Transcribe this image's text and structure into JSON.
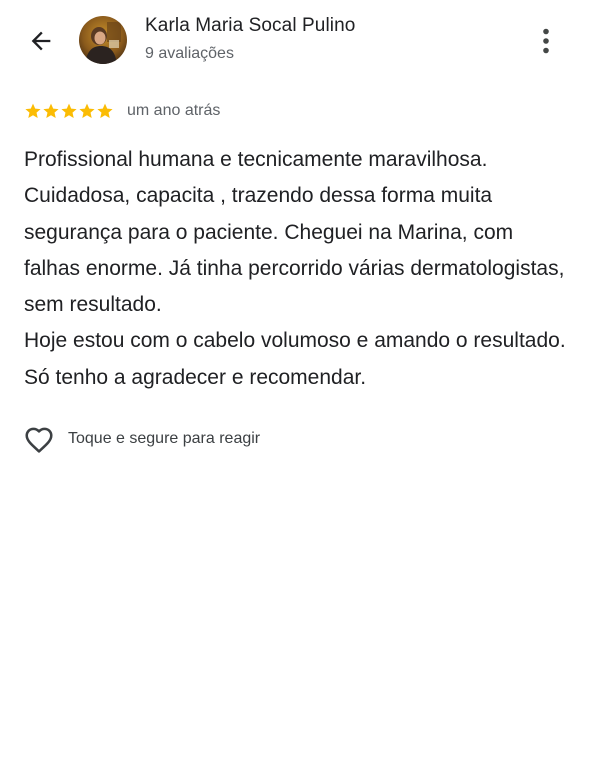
{
  "header": {
    "back_icon": "arrow-back-icon",
    "reviewer_name": "Karla Maria Socal Pulino",
    "reviews_count": "9 avaliações",
    "more_icon": "more-vert-icon"
  },
  "review": {
    "rating": 5,
    "max_rating": 5,
    "star_color": "#fbbc04",
    "time_ago": "um ano atrás",
    "paragraphs": [
      "Profissional humana e tecnicamente maravilhosa. Cuidadosa, capacita , trazendo dessa forma muita segurança para o paciente. Cheguei na Marina, com falhas enorme. Já tinha percorrido várias dermatologistas, sem resultado.",
      "Hoje estou com o cabelo volumoso e amando o resultado. Só tenho a agradecer e recomendar."
    ]
  },
  "reaction": {
    "icon": "heart-outline-icon",
    "label": "Toque e segure para reagir"
  }
}
